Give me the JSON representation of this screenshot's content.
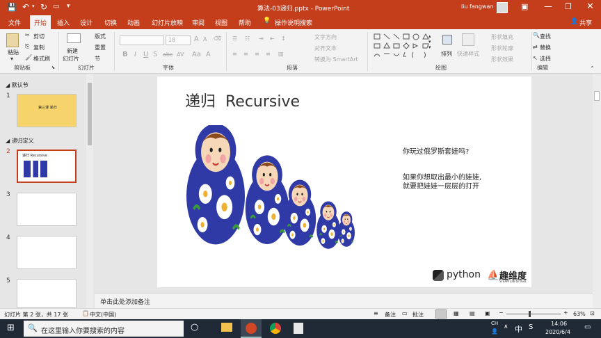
{
  "window": {
    "title": "算法-03递归.pptx - PowerPoint",
    "user": "liu fangwan"
  },
  "tabs": [
    "文件",
    "开始",
    "插入",
    "设计",
    "切换",
    "动画",
    "幻灯片放映",
    "审阅",
    "视图",
    "帮助",
    "操作说明搜索"
  ],
  "share": "共享",
  "ribbon": {
    "clipboard": {
      "paste": "粘贴",
      "cut": "剪切",
      "copy": "复制",
      "format_painter": "格式刷",
      "label": "剪贴板"
    },
    "slides": {
      "new_slide": "新建",
      "new_slide2": "幻灯片",
      "layout": "版式",
      "reset": "重置",
      "section": "节",
      "label": "幻灯片"
    },
    "font": {
      "size": "18",
      "bold": "B",
      "italic": "I",
      "underline": "U",
      "strike": "S",
      "shadow": "abc",
      "spacing": "AV",
      "case": "Aa",
      "label": "字体"
    },
    "paragraph": {
      "text_direction": "文字方向",
      "align_text": "对齐文本",
      "smartart": "转换为 SmartArt",
      "label": "段落"
    },
    "drawing": {
      "arrange": "排列",
      "quick_styles": "快速样式",
      "fill": "形状填充",
      "outline": "形状轮廓",
      "effects": "形状效果",
      "label": "绘图"
    },
    "editing": {
      "find": "查找",
      "replace": "替换",
      "select": "选择",
      "label": "编辑"
    }
  },
  "thumbnails": {
    "section1": "默认节",
    "section2": "递归定义",
    "slide1_title": "第三课 递归",
    "slide2_title": "递归 Recursive",
    "numbers": [
      "1",
      "2",
      "3",
      "4",
      "5"
    ]
  },
  "slide": {
    "title": "递归  Recursive",
    "question": "你玩过俄罗斯套娃吗?",
    "line1": "如果你想取出最小的娃娃,",
    "line2": "就要把娃娃一层层的打开",
    "python_logo": "python",
    "brand": "趣维度",
    "brand_sub": "STEAM Lab for Kids"
  },
  "notes": {
    "placeholder": "单击此处添加备注"
  },
  "status": {
    "slide_info": "幻灯片 第 2 张，共 17 张",
    "language": "中文(中国)",
    "notes_btn": "备注",
    "comments_btn": "批注",
    "zoom": "63%"
  },
  "taskbar": {
    "search": "在这里输入你要搜索的内容",
    "ime_ch": "CH",
    "ime_mode": "中",
    "ime_s": "S",
    "time": "14:06",
    "date": "2020/6/4"
  },
  "colors": {
    "accent": "#c43e1c",
    "doll_blue": "#2f3aa6",
    "taskbar": "#1f2a36"
  }
}
